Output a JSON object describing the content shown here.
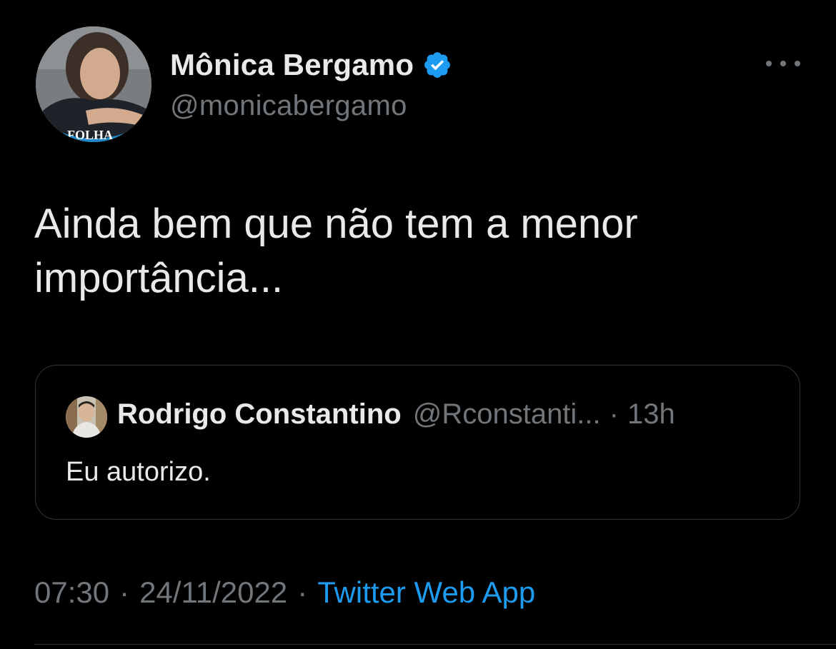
{
  "author": {
    "display_name": "Mônica Bergamo",
    "handle": "@monicabergamo",
    "verified_icon": "verified-badge-icon",
    "avatar_badge_text": "FOLHA"
  },
  "tweet": {
    "text": "Ainda bem que não tem a menor importância..."
  },
  "quoted_tweet": {
    "display_name": "Rodrigo Constantino",
    "handle": "@Rconstanti...",
    "separator": "·",
    "time": "13h",
    "text": "Eu autorizo."
  },
  "footer": {
    "time": "07:30",
    "separator": "·",
    "date": "24/11/2022",
    "source": "Twitter Web App"
  },
  "colors": {
    "background": "#000000",
    "text_primary": "#e7e9ea",
    "text_secondary": "#71767b",
    "accent": "#1d9bf0",
    "border": "#2f3336"
  }
}
